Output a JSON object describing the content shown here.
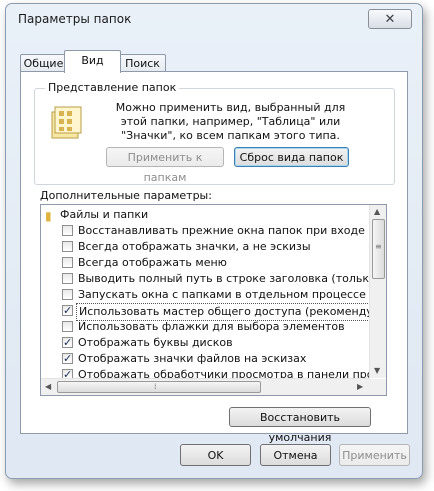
{
  "window": {
    "title": "Параметры папок"
  },
  "tabs": [
    {
      "label": "Общие",
      "active": false
    },
    {
      "label": "Вид",
      "active": true
    },
    {
      "label": "Поиск",
      "active": false
    }
  ],
  "folder_views": {
    "group_title": "Представление папок",
    "description": "Можно применить вид, выбранный для этой папки, например, \"Таблица\" или \"Значки\", ко всем папкам этого типа.",
    "apply_label": "Применить к папкам",
    "reset_label": "Сброс вида папок"
  },
  "advanced": {
    "label": "Дополнительные параметры:",
    "category": "Файлы и папки",
    "items": [
      {
        "label": "Восстанавливать прежние окна папок при входе в си",
        "checked": false
      },
      {
        "label": "Всегда отображать значки, а не эскизы",
        "checked": false
      },
      {
        "label": "Всегда отображать меню",
        "checked": false
      },
      {
        "label": "Выводить полный путь в строке заголовка (только д",
        "checked": false
      },
      {
        "label": "Запускать окна с папками в отдельном процессе",
        "checked": false
      },
      {
        "label": "Использовать мастер общего доступа (рекомендуется)",
        "checked": true
      },
      {
        "label": "Использовать флажки для выбора элементов",
        "checked": false
      },
      {
        "label": "Отображать буквы дисков",
        "checked": true
      },
      {
        "label": "Отображать значки файлов на эскизах",
        "checked": true
      },
      {
        "label": "Отображать обработчики просмотра в панели просм",
        "checked": true
      }
    ]
  },
  "restore_defaults_label": "Восстановить умолчания",
  "footer": {
    "ok": "OK",
    "cancel": "Отмена",
    "apply": "Применить"
  },
  "icons": [
    "close-icon",
    "folder-icon",
    "folder-options-icon",
    "checkbox-icon"
  ]
}
